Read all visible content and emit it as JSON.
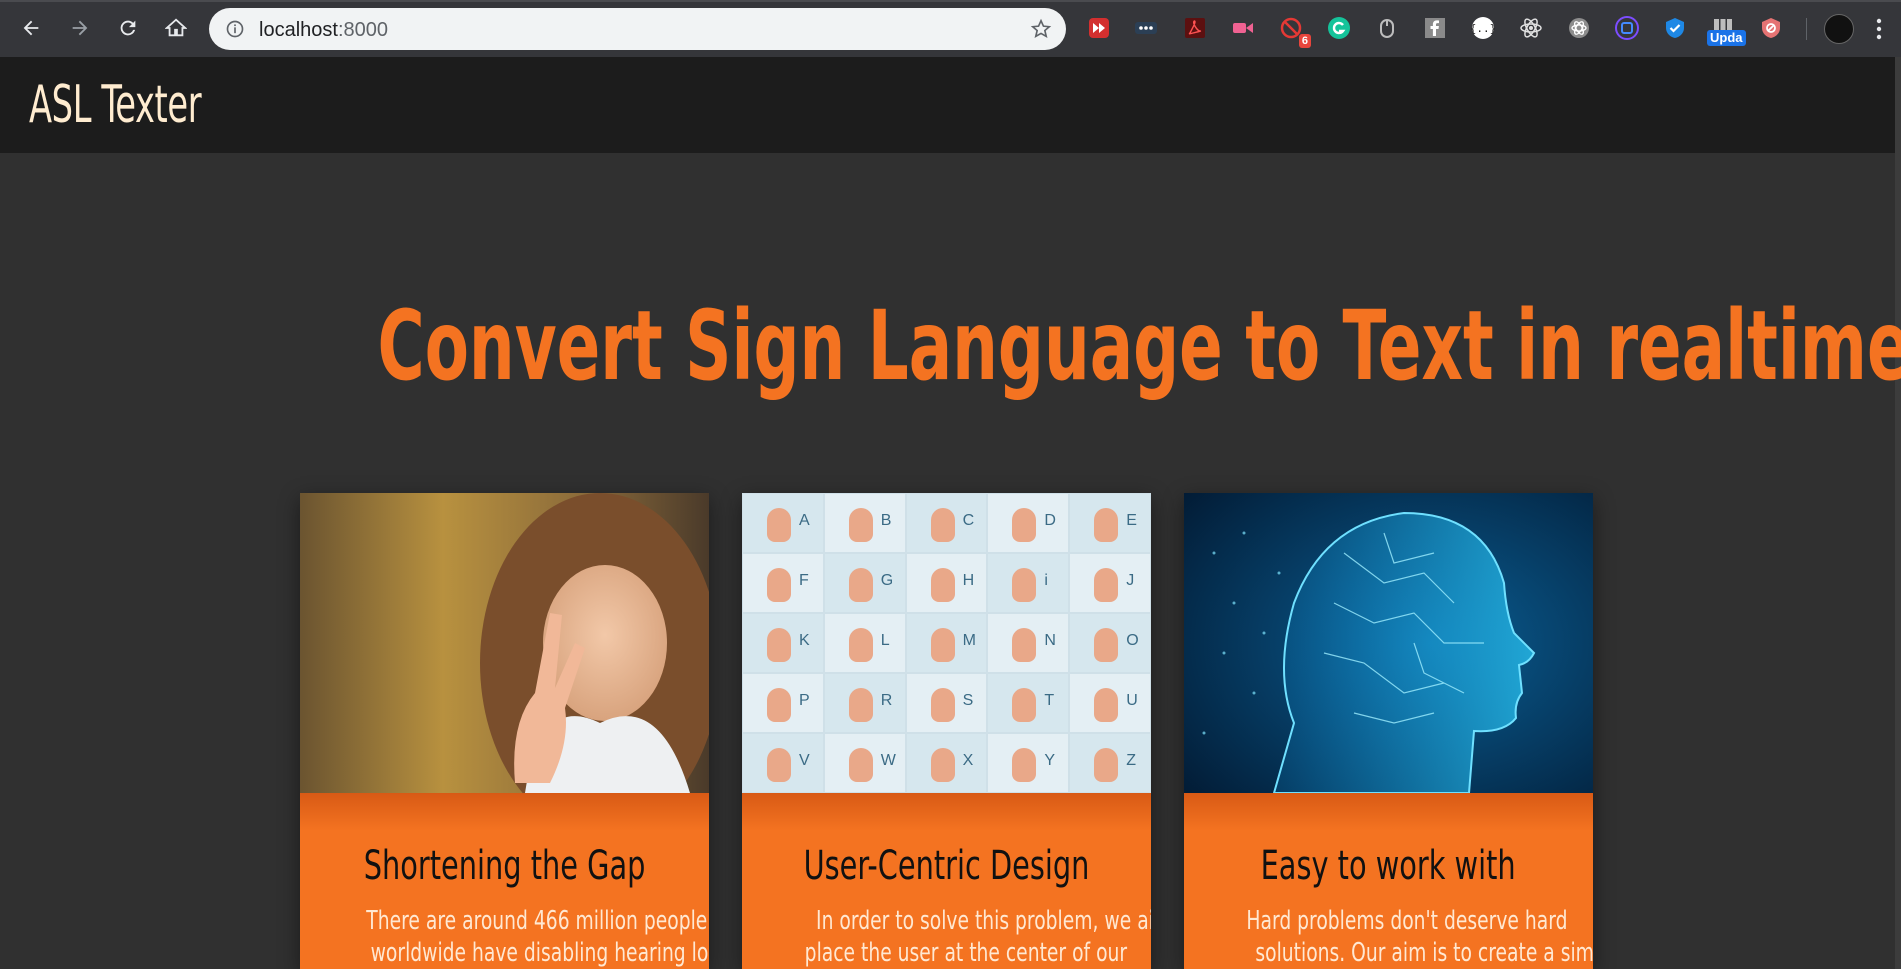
{
  "browser": {
    "url_host": "localhost",
    "url_port": ":8000",
    "extension_badge": "6",
    "update_label": "Upda"
  },
  "site": {
    "brand": "ASL Texter",
    "headline": "Convert Sign Language to Text in realtime"
  },
  "cards": [
    {
      "title": "Shortening the Gap",
      "desc_line1": "There are around 466 million people",
      "desc_line2": "worldwide have disabling hearing loss."
    },
    {
      "title": "User-Centric Design",
      "desc_line1": "In order to solve this problem, we aim to",
      "desc_line2": "place the user at the center of our"
    },
    {
      "title": "Easy to work with",
      "desc_line1": "Hard problems don't deserve hard",
      "desc_line2": "solutions. Our aim is to create a simple"
    }
  ],
  "alphabet": [
    "A",
    "B",
    "C",
    "D",
    "E",
    "F",
    "G",
    "H",
    "i",
    "J",
    "K",
    "L",
    "M",
    "N",
    "O",
    "P",
    "R",
    "S",
    "T",
    "U",
    "V",
    "W",
    "X",
    "Y",
    "Z"
  ],
  "colors": {
    "accent": "#f47321",
    "navbar": "#1c1c1c",
    "page_bg": "#303030",
    "brand_text": "#ffecd0"
  }
}
